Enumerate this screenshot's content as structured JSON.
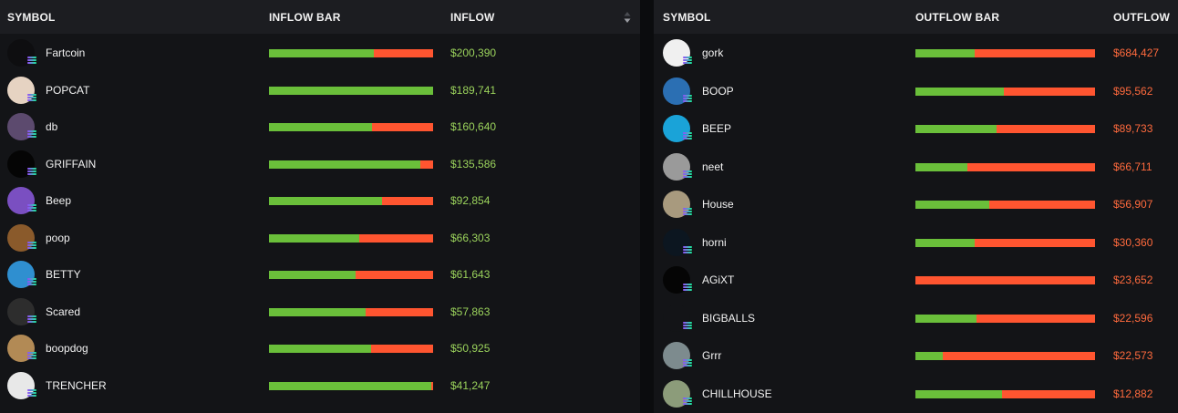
{
  "inflow_table": {
    "headers": {
      "symbol": "SYMBOL",
      "bar": "INFLOW BAR",
      "value": "INFLOW"
    },
    "sort_icon": "sort-arrows-icon",
    "rows": [
      {
        "symbol": "Fartcoin",
        "value": "$200,390",
        "green_fraction": 0.64,
        "avatar_color": "#0e0e10"
      },
      {
        "symbol": "POPCAT",
        "value": "$189,741",
        "green_fraction": 1.0,
        "avatar_color": "#e6d3c2"
      },
      {
        "symbol": "db",
        "value": "$160,640",
        "green_fraction": 0.63,
        "avatar_color": "#5c4a6e"
      },
      {
        "symbol": "GRIFFAIN",
        "value": "$135,586",
        "green_fraction": 0.92,
        "avatar_color": "#050505"
      },
      {
        "symbol": "Beep",
        "value": "$92,854",
        "green_fraction": 0.69,
        "avatar_color": "#7a4fc1"
      },
      {
        "symbol": "poop",
        "value": "$66,303",
        "green_fraction": 0.55,
        "avatar_color": "#8a5a2b"
      },
      {
        "symbol": "BETTY",
        "value": "$61,643",
        "green_fraction": 0.53,
        "avatar_color": "#2f8fd0"
      },
      {
        "symbol": "Scared",
        "value": "$57,863",
        "green_fraction": 0.59,
        "avatar_color": "#2d2d2d"
      },
      {
        "symbol": "boopdog",
        "value": "$50,925",
        "green_fraction": 0.62,
        "avatar_color": "#b28a55"
      },
      {
        "symbol": "TRENCHER",
        "value": "$41,247",
        "green_fraction": 0.99,
        "avatar_color": "#e8e8e8"
      }
    ]
  },
  "outflow_table": {
    "headers": {
      "symbol": "SYMBOL",
      "bar": "OUTFLOW BAR",
      "value": "OUTFLOW"
    },
    "rows": [
      {
        "symbol": "gork",
        "value": "$684,427",
        "green_fraction": 0.33,
        "avatar_color": "#f0f0f0"
      },
      {
        "symbol": "BOOP",
        "value": "$95,562",
        "green_fraction": 0.49,
        "avatar_color": "#2b6fb3"
      },
      {
        "symbol": "BEEP",
        "value": "$89,733",
        "green_fraction": 0.45,
        "avatar_color": "#1aa3d8"
      },
      {
        "symbol": "neet",
        "value": "$66,711",
        "green_fraction": 0.29,
        "avatar_color": "#9a9a9a"
      },
      {
        "symbol": "House",
        "value": "$56,907",
        "green_fraction": 0.41,
        "avatar_color": "#a89a7e"
      },
      {
        "symbol": "horni",
        "value": "$30,360",
        "green_fraction": 0.33,
        "avatar_color": "#0c1620"
      },
      {
        "symbol": "AGiXT",
        "value": "$23,652",
        "green_fraction": 0.0,
        "avatar_color": "#050505"
      },
      {
        "symbol": "BIGBALLS",
        "value": "$22,596",
        "green_fraction": 0.34,
        "avatar_color": "#131417"
      },
      {
        "symbol": "Grrr",
        "value": "$22,573",
        "green_fraction": 0.15,
        "avatar_color": "#7d8b8e"
      },
      {
        "symbol": "CHILLHOUSE",
        "value": "$12,882",
        "green_fraction": 0.48,
        "avatar_color": "#8c9c7a"
      }
    ]
  },
  "colors": {
    "bar_green": "#6abf3a",
    "bar_red": "#ff5530",
    "inflow_value": "#9bd35c",
    "outflow_value": "#ff6a3d"
  },
  "chain_icon": "solana-icon"
}
